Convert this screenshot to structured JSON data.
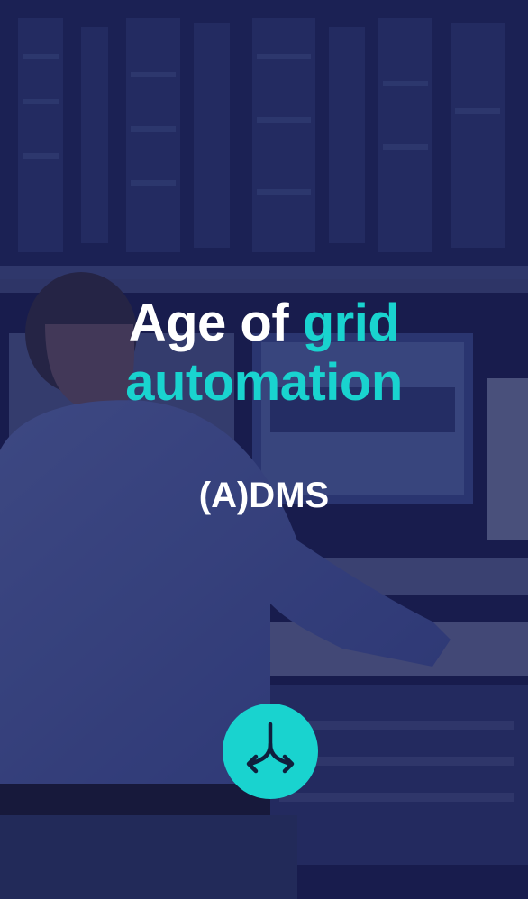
{
  "hero": {
    "title_part1": "Age of ",
    "title_part2": "grid",
    "title_line2": "automation",
    "subtitle": "(A)DMS"
  },
  "action": {
    "icon": "split-arrows-icon"
  },
  "colors": {
    "accent": "#19d3cf",
    "overlay": "#232a5c",
    "text": "#ffffff"
  }
}
